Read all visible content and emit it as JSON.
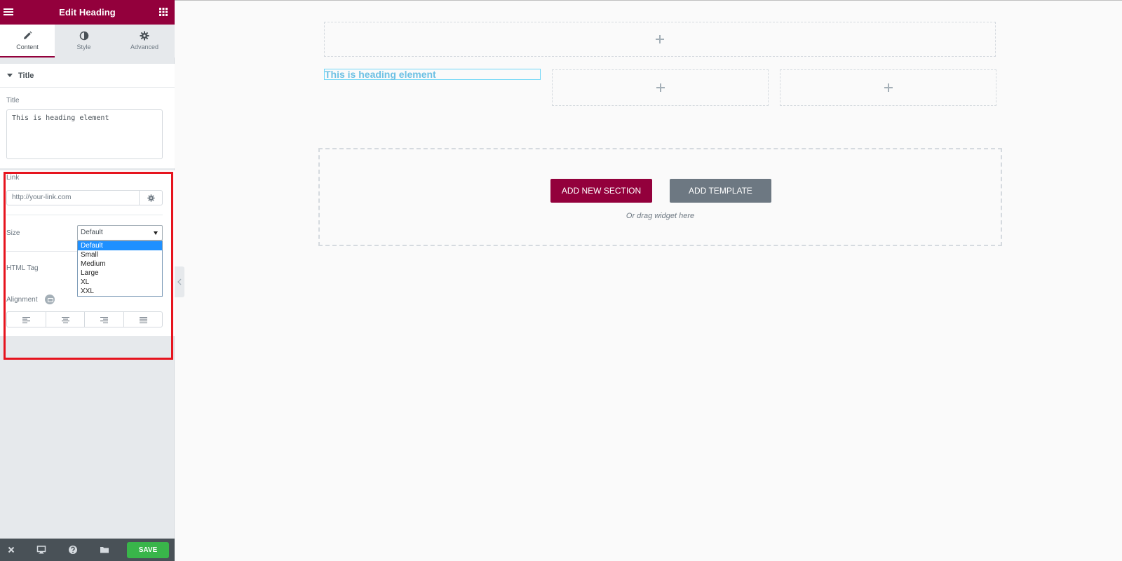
{
  "sidebar": {
    "header_title": "Edit Heading",
    "tabs": [
      {
        "label": "Content",
        "icon": "pencil-icon",
        "active": true
      },
      {
        "label": "Style",
        "icon": "half-circle-icon",
        "active": false
      },
      {
        "label": "Advanced",
        "icon": "gear-icon",
        "active": false
      }
    ],
    "section_title": "Title",
    "title_field": {
      "label": "Title",
      "value": "This is heading element"
    },
    "link_field": {
      "label": "Link",
      "placeholder": "http://your-link.com"
    },
    "size_field": {
      "label": "Size",
      "selected": "Default",
      "options": [
        "Default",
        "Small",
        "Medium",
        "Large",
        "XL",
        "XXL"
      ]
    },
    "html_tag_label": "HTML Tag",
    "alignment_label": "Alignment",
    "footer": {
      "save_label": "SAVE"
    }
  },
  "canvas": {
    "heading_text": "This is heading element",
    "add_new_section_label": "ADD NEW SECTION",
    "add_template_label": "ADD TEMPLATE",
    "drag_hint": "Or drag widget here"
  },
  "colors": {
    "brand": "#93003c",
    "save": "#39b54a",
    "heading": "#6ec1e4",
    "highlight": "#e6141e",
    "panel_bg": "#e6e9ec"
  }
}
